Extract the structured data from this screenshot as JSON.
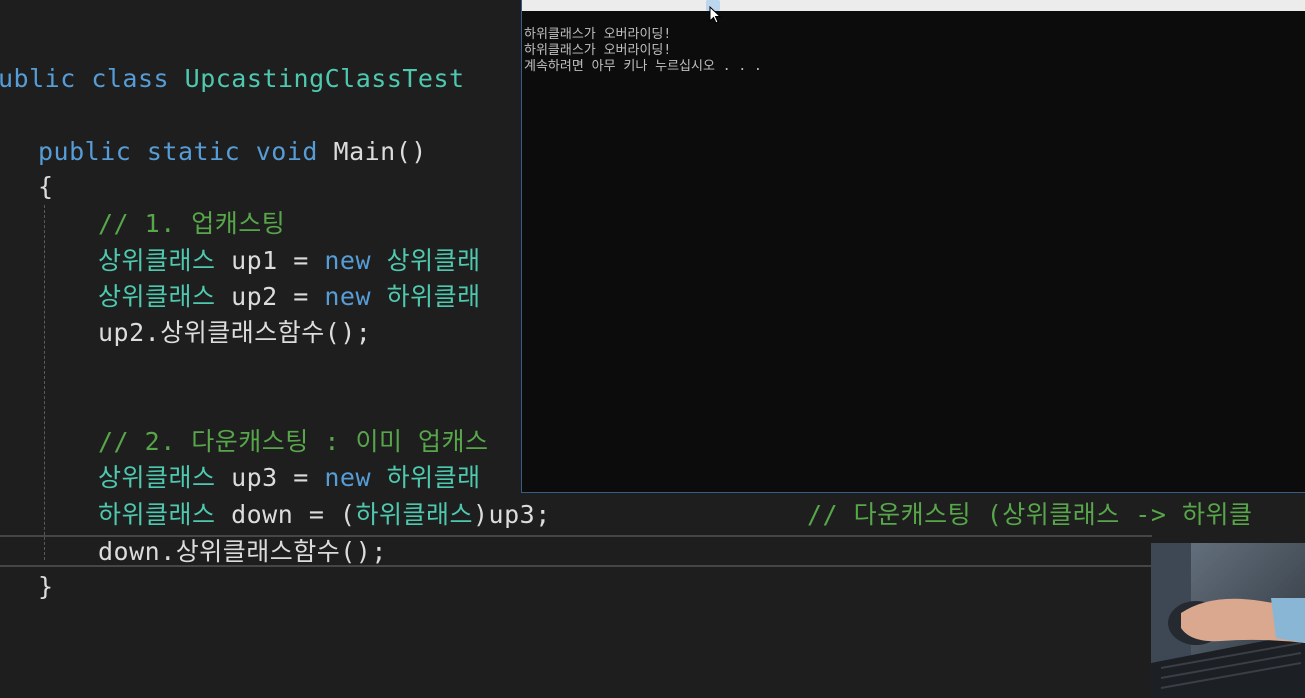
{
  "editor": {
    "lines": [
      {
        "kw1": "ublic",
        "kw2": "class",
        "name": "UpcastingClassTest"
      },
      {
        "kw1": "public",
        "kw2": "static",
        "kw3": "void",
        "name": "Main()"
      },
      {
        "text": "{"
      },
      {
        "comment": "// 1. 업캐스팅"
      },
      {
        "type": "상위클래스",
        "mid": " up1 = ",
        "kw": "new",
        "type2": " 상위클래"
      },
      {
        "type": "상위클래스",
        "mid": " up2 = ",
        "kw": "new",
        "type2": " 하위클래"
      },
      {
        "text": "up2.상위클래스함수();"
      },
      {
        "comment": "// 2. 다운캐스팅 : 이미 업캐스"
      },
      {
        "type": "상위클래스",
        "mid": " up3 = ",
        "kw": "new",
        "type2": " 하위클래"
      },
      {
        "type": "하위클래스",
        "mid": " down = (",
        "type2": "하위클래스",
        "end": ")up3;",
        "comment": "// 다운캐스팅 (상위클래스 -> 하위클"
      },
      {
        "text": "down.상위클래스함수();"
      },
      {
        "text": "}"
      }
    ]
  },
  "console": {
    "lines": [
      "하위클래스가 오버라이딩!",
      "하위클래스가 오버라이딩!",
      "계속하려면 아무 키나 누르십시오 . . ."
    ]
  },
  "icons": {
    "cursor": "mouse-pointer-icon"
  }
}
